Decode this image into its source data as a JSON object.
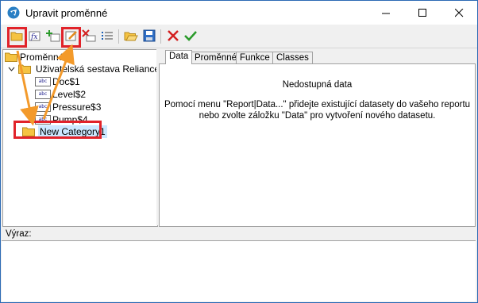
{
  "window": {
    "title": "Upravit proměnné",
    "minimize_icon": "minimize-icon",
    "maximize_icon": "maximize-icon",
    "close_icon": "close-icon"
  },
  "toolbar": {
    "buttons": [
      {
        "name": "new-category-button",
        "icon": "folder-icon",
        "highlighted": true
      },
      {
        "name": "new-function-button",
        "icon": "function-icon"
      },
      {
        "name": "new-variable-button",
        "icon": "add-variable-icon"
      },
      {
        "name": "edit-button",
        "icon": "edit-icon",
        "highlighted": true
      },
      {
        "name": "delete-button",
        "icon": "delete-icon"
      },
      {
        "name": "list-button",
        "icon": "list-icon"
      },
      {
        "name": "open-button",
        "icon": "open-folder-icon"
      },
      {
        "name": "save-button",
        "icon": "save-icon"
      },
      {
        "name": "cancel-button",
        "icon": "cross-icon",
        "color": "#d32020"
      },
      {
        "name": "confirm-button",
        "icon": "check-icon",
        "color": "#2a9a2a"
      }
    ]
  },
  "tree": {
    "root": "Proměnné",
    "report": "Uživatelská sestava Reliance",
    "variables": [
      "Doc$1",
      "Level$2",
      "Pressure$3",
      "Pump$4"
    ],
    "new_category": "New Category1"
  },
  "tabs": [
    "Data",
    "Proměnné",
    "Funkce",
    "Classes"
  ],
  "active_tab": "Data",
  "data_panel": {
    "heading": "Nedostupná data",
    "line1": "Pomocí menu \"Report|Data...\" přidejte existující datasety do vašeho reportu",
    "line2": "nebo zvolte záložku \"Data\" pro vytvoření nového datasetu."
  },
  "expression": {
    "label": "Výraz:",
    "value": ""
  },
  "colors": {
    "highlight": "#e1232a",
    "arrow": "#f39a2b",
    "selection": "#cce8ff"
  }
}
